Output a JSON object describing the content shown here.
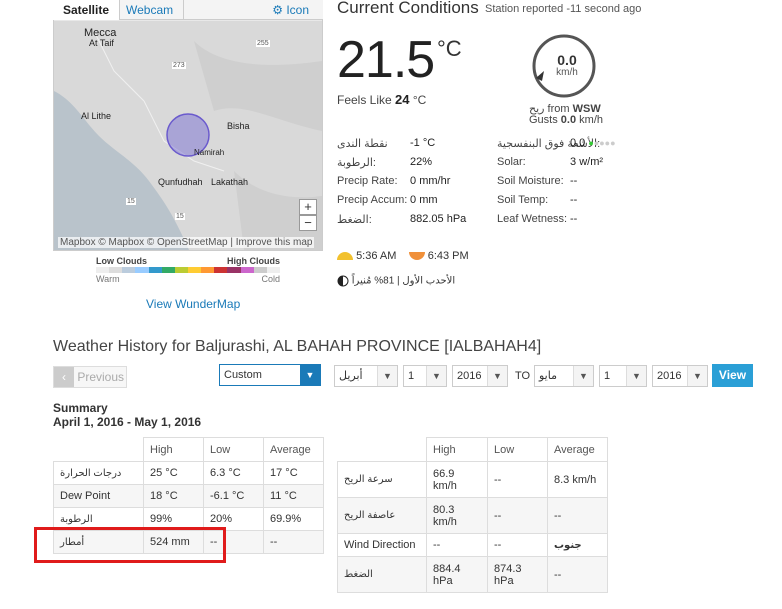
{
  "map": {
    "tabs": [
      "Satellite",
      "Webcam"
    ],
    "icon_link": "Icon",
    "places": [
      {
        "name": "Mecca"
      },
      {
        "name": "At Taif"
      },
      {
        "name": "Al Lithe"
      },
      {
        "name": "Bisha"
      },
      {
        "name": "Namirah"
      },
      {
        "name": "Qunfudhah"
      },
      {
        "name": "Lakathah"
      }
    ],
    "roads": [
      "255",
      "273",
      "15",
      "15"
    ],
    "attribution": "Mapbox © Mapbox © OpenStreetMap | Improve this map",
    "zoom_in": "+",
    "zoom_out": "−",
    "cloud_legend": {
      "low": "Low Clouds",
      "high": "High Clouds",
      "warm": "Warm",
      "cold": "Cold"
    },
    "view_link": "View WunderMap"
  },
  "current": {
    "title": "Current Conditions",
    "station_reported": "Station reported -11 second ago",
    "temp": "21.5",
    "temp_unit": "°C",
    "feels_like_label": "Feels Like",
    "feels_like_value": "24",
    "feels_like_unit": "°C",
    "wind_speed": "0.0",
    "wind_unit": "km/h",
    "wind_from_label": "ريح from",
    "wind_from_value": "WSW",
    "gusts_label": "Gusts",
    "gusts_value": "0.0",
    "gusts_unit": "km/h",
    "left_rows": [
      {
        "label": "نقطة الندى",
        "value": "-1",
        "unit": "°C"
      },
      {
        "label": "الرطوبة:",
        "value": "22%",
        "unit": ""
      },
      {
        "label": "Precip Rate:",
        "value": "0",
        "unit": "mm/hr"
      },
      {
        "label": "Precip Accum:",
        "value": "0",
        "unit": "mm"
      },
      {
        "label": "الضغط:",
        "value": "882.05",
        "unit": "hPa"
      }
    ],
    "right_rows": [
      {
        "label": "الأشعة فوق البنفسجية:",
        "value": "0.0",
        "unit": ""
      },
      {
        "label": "Solar:",
        "value": "3",
        "unit": "w/m²"
      },
      {
        "label": "Soil Moisture:",
        "value": "--",
        "unit": ""
      },
      {
        "label": "Soil Temp:",
        "value": "--",
        "unit": ""
      },
      {
        "label": "Leaf Wetness:",
        "value": "--",
        "unit": ""
      }
    ],
    "sunrise": "5:36 AM",
    "sunset": "6:43 PM",
    "moon": "الأحدب الأول | 81% مُنيراً"
  },
  "history": {
    "title": "Weather History for Baljurashi, AL BAHAH PROVINCE [IALBAHAH4]",
    "prev_label": "Previous",
    "mode": "Custom",
    "from_month": "أبريل",
    "from_day": "1",
    "from_year": "2016",
    "to_label": "TO",
    "to_month": "مايو",
    "to_day": "1",
    "to_year": "2016",
    "view_label": "View",
    "summary_title": "Summary",
    "summary_range": "April 1, 2016 - May 1, 2016",
    "left_table": {
      "headers": [
        "",
        "High",
        "Low",
        "Average"
      ],
      "rows": [
        [
          "درجات الحرارة",
          "25 °C",
          "6.3 °C",
          "17 °C"
        ],
        [
          "Dew Point",
          "18 °C",
          "-6.1 °C",
          "11 °C"
        ],
        [
          "الرطوبة",
          "99%",
          "20%",
          "69.9%"
        ],
        [
          "أمطار",
          "524 mm",
          "--",
          "--"
        ]
      ]
    },
    "right_table": {
      "headers": [
        "",
        "High",
        "Low",
        "Average"
      ],
      "rows": [
        [
          "سرعة الريح",
          "66.9 km/h",
          "--",
          "8.3 km/h"
        ],
        [
          "عاصفة الريح",
          "80.3 km/h",
          "--",
          "--"
        ],
        [
          "Wind Direction",
          "--",
          "--",
          "جنوب"
        ],
        [
          "الضغط",
          "884.4 hPa",
          "874.3 hPa",
          "--"
        ]
      ]
    }
  },
  "colors": {
    "accent": "#1a7ab8",
    "highlight": "#e01b1b",
    "view_button": "#2a9fd6",
    "sun": "#f2c12e",
    "sunset": "#f0903a"
  }
}
